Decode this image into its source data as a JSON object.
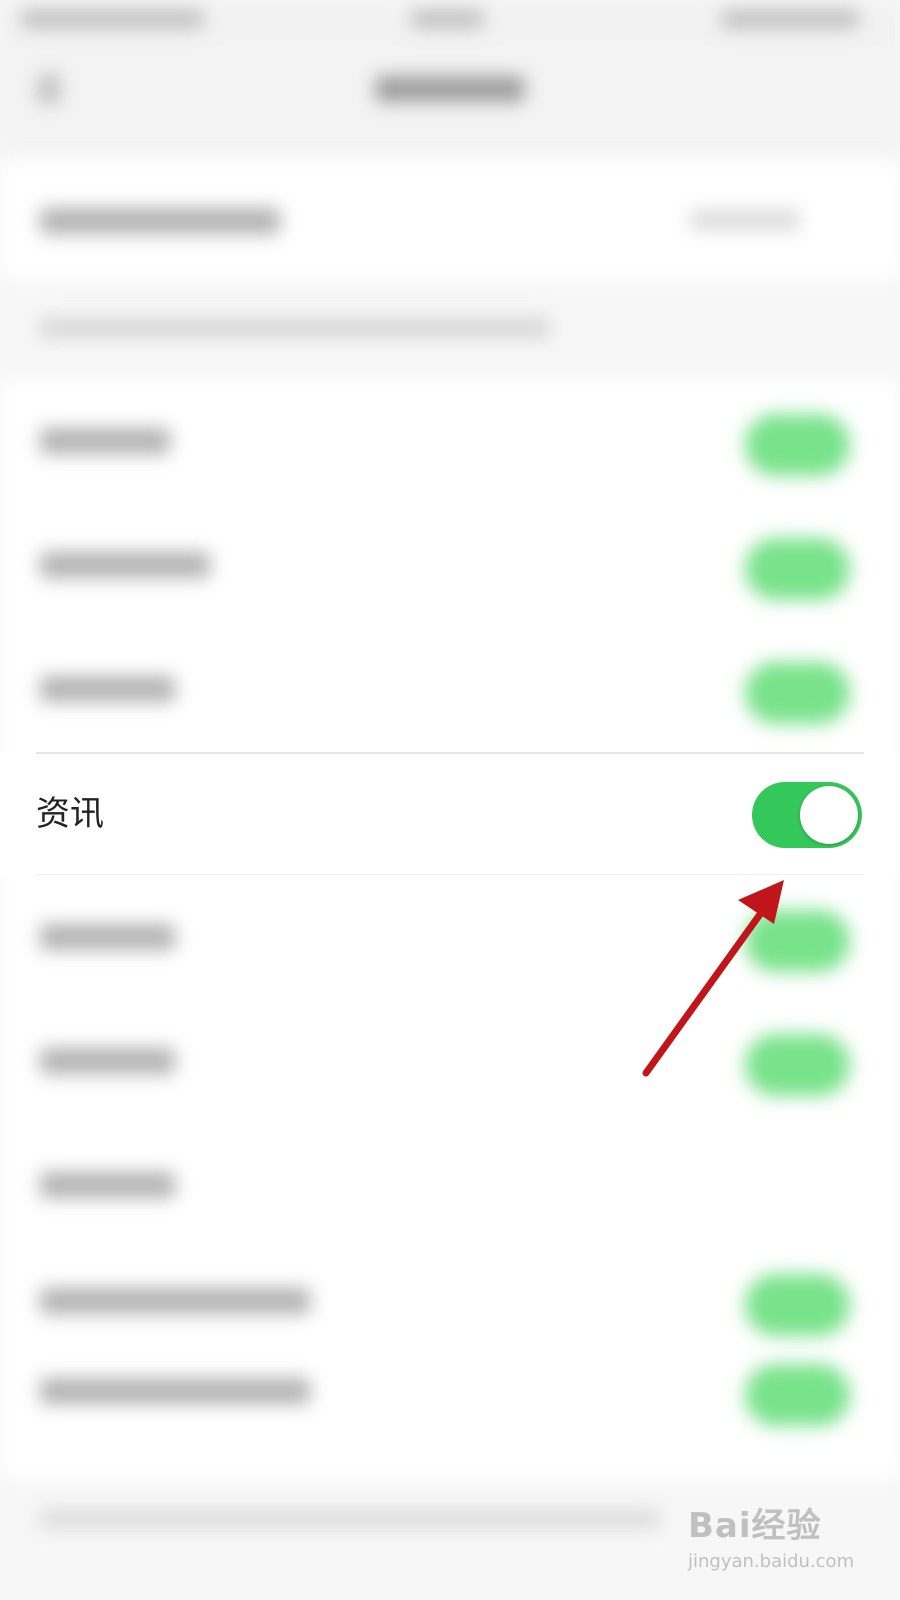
{
  "focused_setting": {
    "label": "资讯",
    "toggle_on": true,
    "toggle_color": "#34c759"
  },
  "blurred_rows": [
    {
      "has_toggle": true
    },
    {
      "has_toggle": true
    },
    {
      "has_toggle": true
    },
    {
      "has_toggle": true
    },
    {
      "has_toggle": true
    },
    {
      "has_toggle": false
    },
    {
      "has_toggle": true
    },
    {
      "has_toggle": true
    }
  ],
  "annotation": {
    "type": "arrow",
    "color": "#c0161b",
    "points_to": "toggle"
  },
  "watermark": {
    "logo": "Bai经验",
    "url": "jingyan.baidu.com"
  }
}
